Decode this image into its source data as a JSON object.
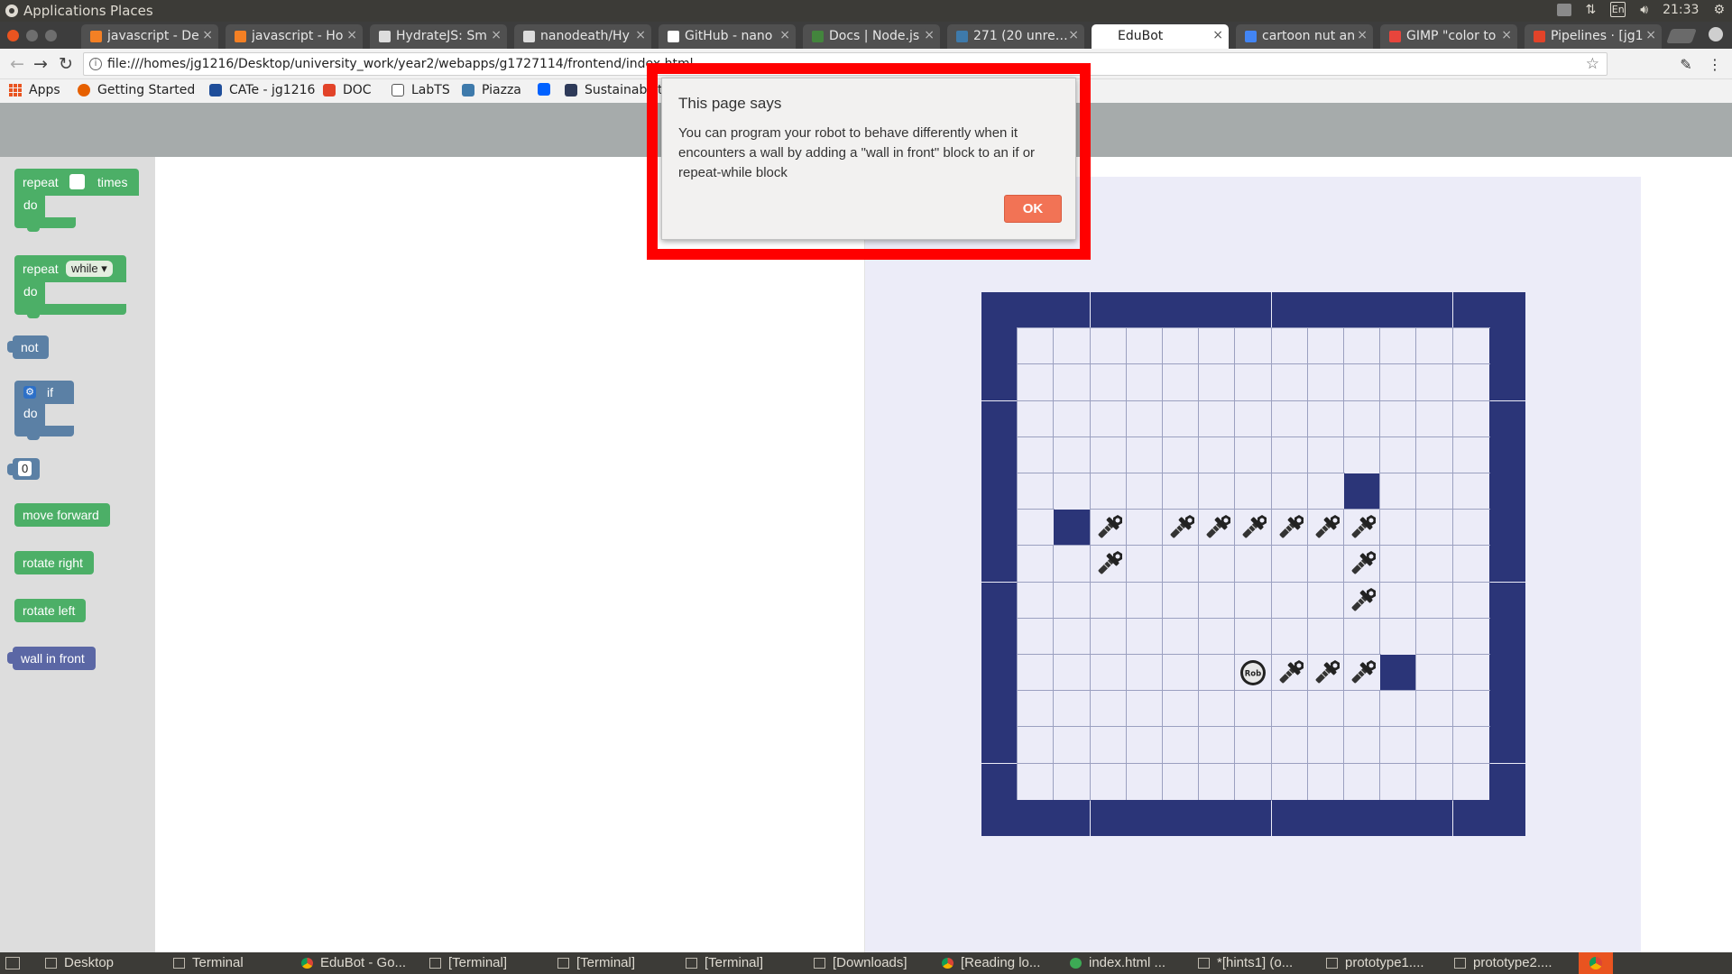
{
  "os_panel": {
    "menu_applications": "Applications",
    "menu_places": "Places",
    "keyboard_layout": "En",
    "clock": "21:33"
  },
  "tabs": [
    {
      "title": "javascript - De",
      "color": "#f48024"
    },
    {
      "title": "javascript - Ho",
      "color": "#f48024"
    },
    {
      "title": "HydrateJS: Sm",
      "color": "#dddddd"
    },
    {
      "title": "nanodeath/Hy",
      "color": "#dddddd"
    },
    {
      "title": "GitHub - nano",
      "color": "#ffffff"
    },
    {
      "title": "Docs | Node.js",
      "color": "#43853d"
    },
    {
      "title": "271 (20 unread",
      "color": "#3e7aab"
    },
    {
      "title": "EduBot",
      "color": "#ffffff",
      "active": true
    },
    {
      "title": "cartoon nut an",
      "color": "#4285f4"
    },
    {
      "title": "GIMP \"color to",
      "color": "#e8453c"
    },
    {
      "title": "Pipelines · [jg1",
      "color": "#e24329"
    }
  ],
  "address_bar": {
    "url": "file:///homes/jg1216/Desktop/university_work/year2/webapps/g1727114/frontend/index.html"
  },
  "bookmarks": [
    {
      "label": "Apps",
      "icon": "apps-grid-icon",
      "color": "#e95420"
    },
    {
      "label": "Getting Started",
      "icon": "firefox-icon",
      "color": "#e66000"
    },
    {
      "label": "CATe - jg1216",
      "icon": "cate-icon",
      "color": "#1f4e9a"
    },
    {
      "label": "DOC",
      "icon": "gitlab-icon",
      "color": "#e24329"
    },
    {
      "label": "LabTS",
      "icon": "page-icon",
      "color": "#ffffff"
    },
    {
      "label": "Piazza",
      "icon": "piazza-icon",
      "color": "#3e7aab"
    },
    {
      "label": "",
      "icon": "dropbox-icon",
      "color": "#0061ff"
    },
    {
      "label": "Sustainabilit",
      "icon": "leaf-icon",
      "color": "#2e3a59"
    }
  ],
  "toolbox": {
    "repeat_times_label": "repeat",
    "times_label": "times",
    "do_label": "do",
    "repeat_while_label": "repeat",
    "while_option": "while",
    "not_label": "not",
    "if_label": "if",
    "number_value": "0",
    "move_forward": "move forward",
    "rotate_right": "rotate right",
    "rotate_left": "rotate left",
    "wall_in_front": "wall in front"
  },
  "dialog": {
    "title": "This page says",
    "message": "You can program your robot to behave differently when it encounters a wall by adding a \"wall in front\" block to an if or repeat-while block",
    "ok_label": "OK"
  },
  "grid": {
    "rows": 15,
    "cols": 15,
    "wall_color": "#2b3578",
    "floor_color": "#ececf8",
    "inner_walls": [
      [
        5,
        10
      ],
      [
        6,
        2
      ],
      [
        10,
        11
      ]
    ],
    "nuts": [
      [
        6,
        3
      ],
      [
        6,
        5
      ],
      [
        6,
        6
      ],
      [
        6,
        7
      ],
      [
        6,
        8
      ],
      [
        6,
        9
      ],
      [
        6,
        10
      ],
      [
        7,
        3
      ],
      [
        7,
        10
      ],
      [
        8,
        10
      ],
      [
        10,
        8
      ],
      [
        10,
        9
      ],
      [
        10,
        10
      ]
    ],
    "robot": {
      "row": 10,
      "col": 7,
      "label": "Rob"
    }
  },
  "taskbar": [
    {
      "label": "Desktop",
      "icon": "folder"
    },
    {
      "label": "Terminal",
      "icon": "terminal"
    },
    {
      "label": "EduBot - Go...",
      "icon": "chrome"
    },
    {
      "label": "[Terminal]",
      "icon": "terminal"
    },
    {
      "label": "[Terminal]",
      "icon": "terminal"
    },
    {
      "label": "[Terminal]",
      "icon": "terminal"
    },
    {
      "label": "[Downloads]",
      "icon": "folder"
    },
    {
      "label": "[Reading lo...",
      "icon": "chrome"
    },
    {
      "label": "index.html ...",
      "icon": "green"
    },
    {
      "label": "*[hints1] (o...",
      "icon": "editor"
    },
    {
      "label": "prototype1....",
      "icon": "image"
    },
    {
      "label": "prototype2....",
      "icon": "image"
    }
  ]
}
